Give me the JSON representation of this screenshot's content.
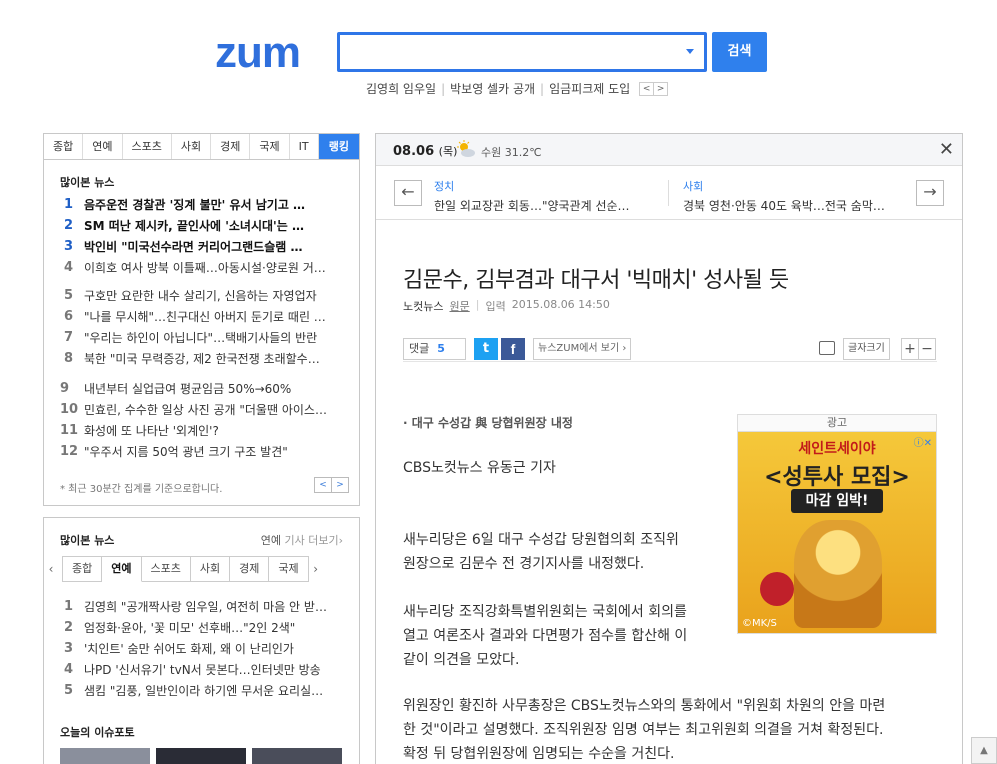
{
  "header": {
    "logo": "zum",
    "search_button": "검색",
    "search_value": "",
    "trending": [
      "김영희 임우일",
      "박보영 셀카 공개",
      "임금피크제 도입"
    ],
    "trend_prev": "<",
    "trend_next": ">"
  },
  "left_panel": {
    "tabs": [
      "종합",
      "연예",
      "스포츠",
      "사회",
      "경제",
      "국제",
      "IT",
      "랭킹"
    ],
    "active_tab": "랭킹",
    "section_title": "많이본 뉴스",
    "items": [
      {
        "rank": "1",
        "text": "음주운전 경찰관 '징계 불만' 유서 남기고 …"
      },
      {
        "rank": "2",
        "text": "SM 떠난 제시카, 끝인사에 '소녀시대'는 …"
      },
      {
        "rank": "3",
        "text": "박인비 \"미국선수라면 커리어그랜드슬램 …"
      },
      {
        "rank": "4",
        "text": "이희호 여사 방북 이틀째…아동시설·양로원 거…"
      },
      {
        "rank": "5",
        "text": "구호만 요란한 내수 살리기, 신음하는 자영업자"
      },
      {
        "rank": "6",
        "text": "\"나를 무시해\"…친구대신 아버지 둔기로 때린 …"
      },
      {
        "rank": "7",
        "text": "\"우리는 하인이 아닙니다\"…택배기사들의 반란"
      },
      {
        "rank": "8",
        "text": "북한 \"미국 무력증강, 제2 한국전쟁 초래할수…"
      },
      {
        "rank": "9",
        "text": "내년부터 실업급여 평균임금 50%→60%"
      },
      {
        "rank": "10",
        "text": "민효린, 수수한 일상 사진 공개 \"더울땐 아이스…"
      },
      {
        "rank": "11",
        "text": "화성에 또 나타난 '외계인'?"
      },
      {
        "rank": "12",
        "text": "\"우주서 지름 50억 광년 크기 구조 발견\""
      }
    ],
    "footnote": "* 최근 30분간 집계를 기준으로합니다.",
    "prev": "<",
    "next": ">"
  },
  "left_panel2": {
    "title": "많이본 뉴스",
    "more_category": "연예",
    "more_text": "기사 더보기",
    "tabs": [
      "종합",
      "연예",
      "스포츠",
      "사회",
      "경제",
      "국제"
    ],
    "active_tab": "연예",
    "items": [
      {
        "rank": "1",
        "text": "김영희 \"공개짝사랑 임우일, 여전히 마음 안 받…"
      },
      {
        "rank": "2",
        "text": "엄정화·윤아, '꽃 미모' 선후배…\"2인 2색\""
      },
      {
        "rank": "3",
        "text": "'치인트' 숨만 쉬어도 화제, 왜 이 난리인가"
      },
      {
        "rank": "4",
        "text": "나PD '신서유기' tvN서 못본다…인터넷만 방송"
      },
      {
        "rank": "5",
        "text": "샘킴 \"김풍, 일반인이라 하기엔 무서운 요리실…"
      }
    ],
    "issue_title": "오늘의 이슈포토"
  },
  "article_panel": {
    "date": "08.06",
    "day": "(목)",
    "weather": "수원 31.2℃",
    "ticker": [
      {
        "category": "정치",
        "text": "한일 외교장관 회동…\"양국관계 선순…"
      },
      {
        "category": "사회",
        "text": "경북 영천·안동 40도 육박…전국 숨막…"
      }
    ],
    "headline": "김문수, 김부겸과 대구서 '빅매치' 성사될 듯",
    "source": "노컷뉴스",
    "original_link": "원문",
    "input_label": "입력",
    "timestamp": "2015.08.06 14:50",
    "comments_label": "댓글",
    "comments_count": "5",
    "view_on_zum": "뉴스ZUM에서 보기",
    "font_size_label": "글자크기",
    "subhead": "· 대구 수성갑 與 당협위원장 내정",
    "byline": "CBS노컷뉴스 유동근 기자",
    "paragraphs": [
      "새누리당은 6일 대구 수성갑 당원협의회 조직위",
      "원장으로 김문수 전 경기지사를 내정했다.",
      "새누리당 조직강화특별위원회는 국회에서 회의를",
      "열고 여론조사 결과와 다면평가 점수를 합산해 이",
      "같이 의견을 모았다.",
      "위원장인 황진하 사무총장은 CBS노컷뉴스와의 통화에서 \"위원회 차원의 안을 마련",
      "한 것\"이라고 설명했다. 조직위원장 임명 여부는 최고위원회 의결을 거쳐 확정된다.",
      "확정 뒤 당협위원장에 임명되는 수순을 거친다."
    ],
    "ad": {
      "label": "광고",
      "line1": "세인트세이야",
      "line2": "<성투사 모집>",
      "line3": "마감 임박!",
      "copyright": "©MK/S"
    }
  },
  "colors": {
    "brand": "#2f80ed",
    "logo": "#2f6fdc"
  }
}
